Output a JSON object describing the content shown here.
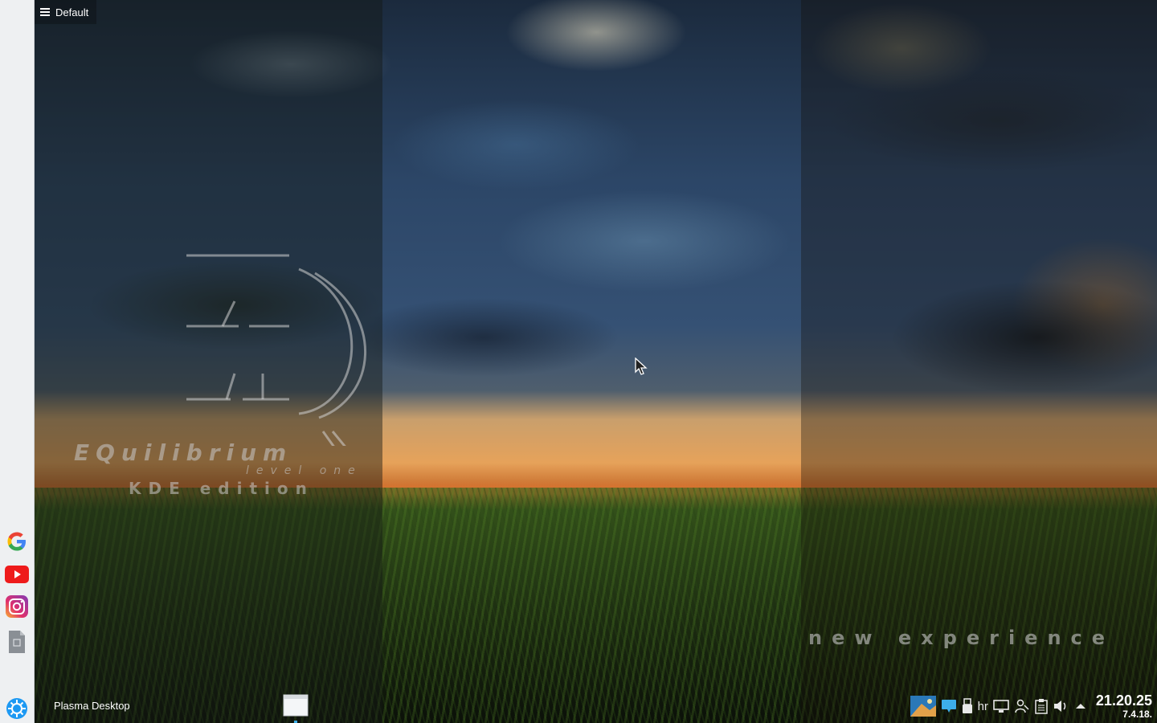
{
  "activity": {
    "label": "Default"
  },
  "launcher": {
    "items": [
      {
        "name": "Google",
        "icon": "google-icon"
      },
      {
        "name": "YouTube",
        "icon": "youtube-icon"
      },
      {
        "name": "Instagram",
        "icon": "instagram-icon"
      },
      {
        "name": "Document",
        "icon": "document-icon"
      }
    ],
    "menu_icon": "kde-application-launcher-icon"
  },
  "wallpaper": {
    "brand_title": "EQuilibrium",
    "brand_level": "level one",
    "brand_edition": "KDE edition",
    "brand_tagline": "new experience"
  },
  "taskbar": {
    "task_label": "Plasma Desktop",
    "tray": {
      "keyboard_layout": "hr",
      "clock_time": "21.20.25",
      "clock_date": "7.4.18."
    }
  },
  "colors": {
    "accent": "#3daee9",
    "panel_left": "#eef0f2"
  }
}
